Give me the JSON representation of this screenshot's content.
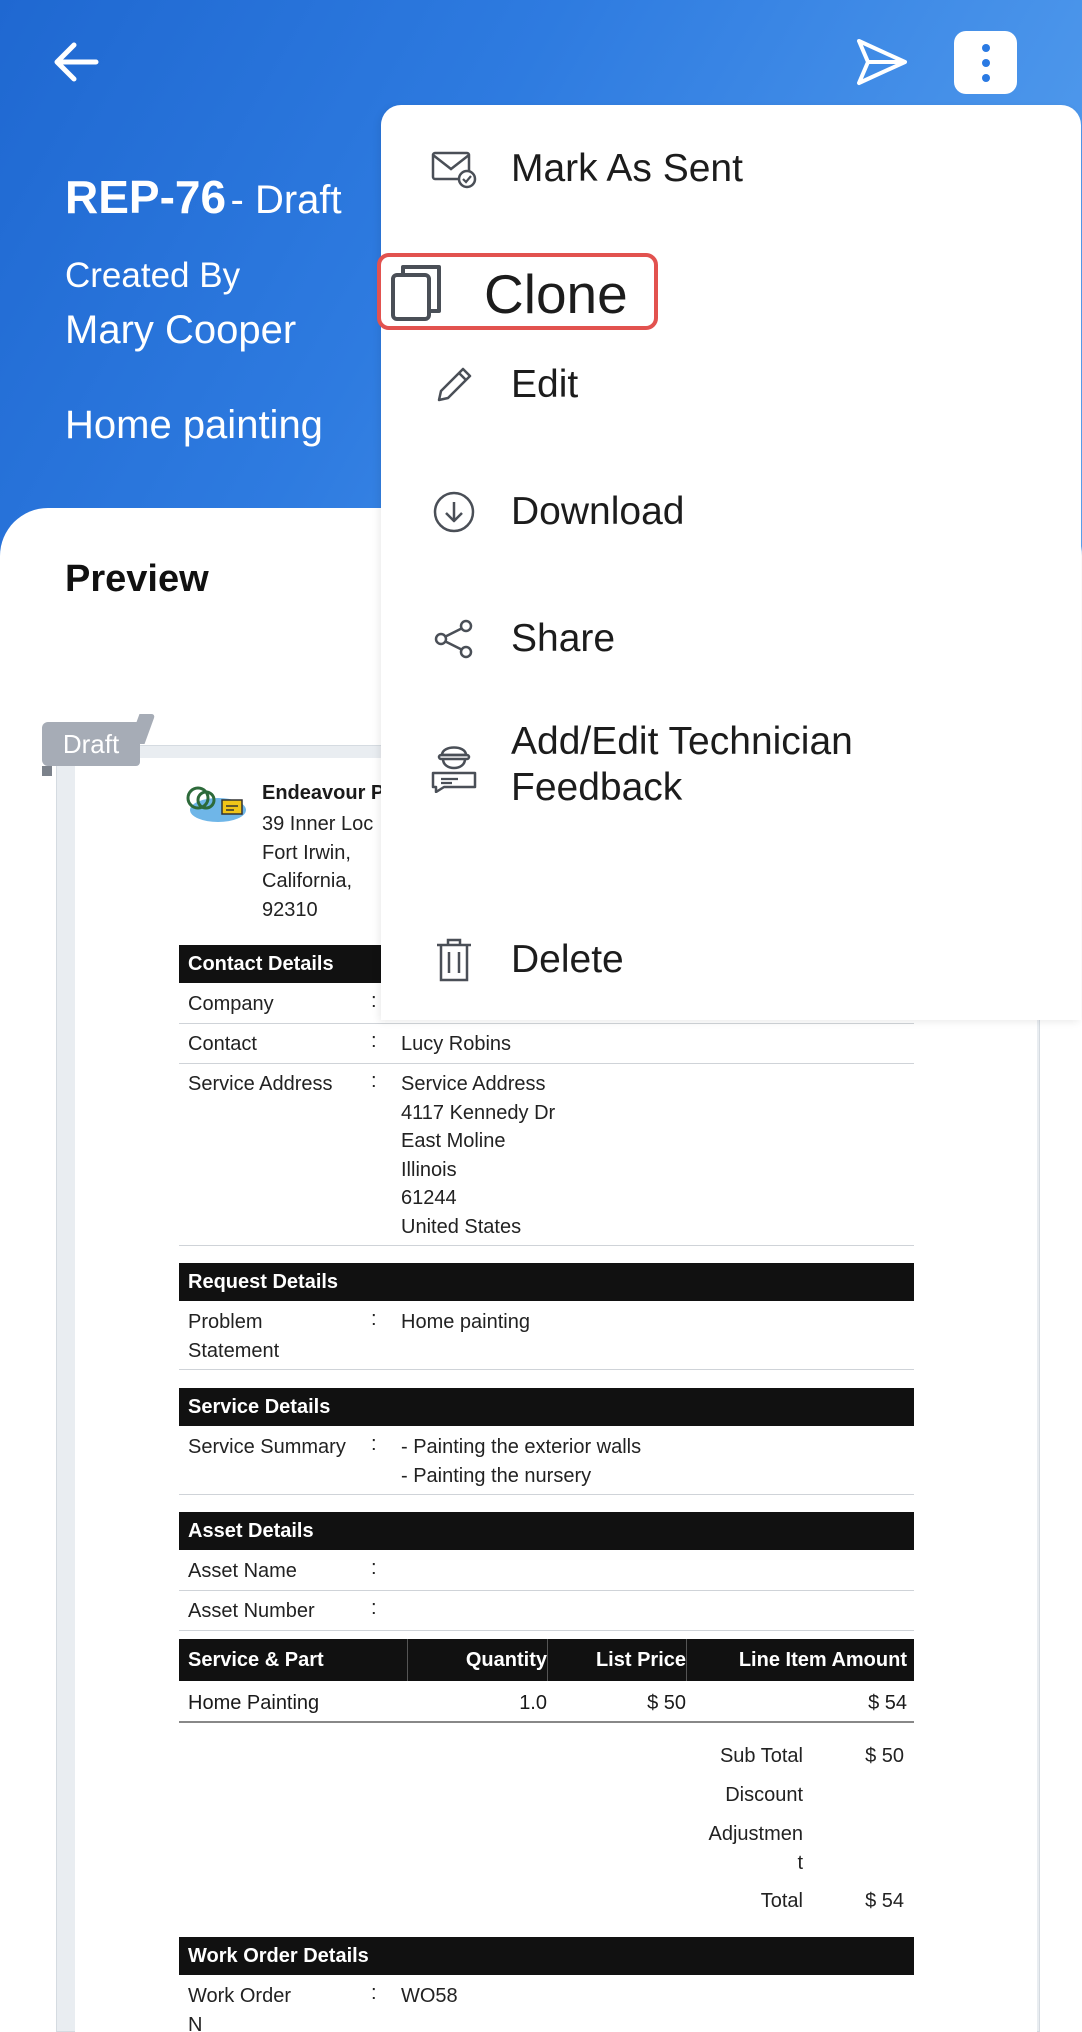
{
  "header": {
    "ref_no": "REP-76",
    "status_text": "- Draft",
    "created_by_label": "Created By",
    "created_by_name": "Mary Cooper",
    "job_title": "Home painting",
    "colors": {
      "primary": "#1f68d1",
      "accent_light": "#5aa3f0"
    }
  },
  "icons": {
    "back": "arrow-left-icon",
    "send": "send-icon",
    "more": "more-vertical-icon"
  },
  "preview": {
    "title": "Preview",
    "draft_tag": "Draft",
    "company": {
      "name": "Endeavour P",
      "address_lines": [
        "39 Inner Loc",
        "Fort Irwin,",
        "California,",
        "92310"
      ]
    },
    "contact_details": {
      "header": "Contact Details",
      "rows": [
        {
          "label": "Company",
          "colon": ":",
          "value": ""
        },
        {
          "label": "Contact",
          "colon": ":",
          "value": "Lucy Robins"
        },
        {
          "label": "Service Address",
          "colon": ":",
          "value_lines": [
            "Service Address",
            "4117 Kennedy Dr",
            "East Moline",
            "Illinois",
            "61244",
            "United States"
          ]
        }
      ]
    },
    "request_details": {
      "header": "Request Details",
      "rows": [
        {
          "label_lines": [
            "Problem",
            "Statement"
          ],
          "colon": ":",
          "value": "Home painting"
        }
      ]
    },
    "service_details": {
      "header": "Service Details",
      "rows": [
        {
          "label": "Service Summary",
          "colon": ":",
          "value_lines": [
            "- Painting the exterior walls",
            "- Painting the nursery"
          ]
        }
      ]
    },
    "asset_details": {
      "header": "Asset Details",
      "rows": [
        {
          "label": "Asset Name",
          "colon": ":",
          "value": ""
        },
        {
          "label": "Asset Number",
          "colon": ":",
          "value": ""
        }
      ]
    },
    "service_parts": {
      "columns": [
        "Service & Part",
        "Quantity",
        "List Price",
        "Line Item Amount"
      ],
      "rows": [
        [
          "Home Painting",
          "1.0",
          "$ 50",
          "$ 54"
        ]
      ]
    },
    "totals": [
      {
        "label": "Sub Total",
        "value": "$ 50"
      },
      {
        "label": "Discount",
        "value": ""
      },
      {
        "label_lines": [
          "Adjustmen",
          "t"
        ],
        "value": ""
      },
      {
        "label": "Total",
        "value": "$ 54"
      }
    ],
    "work_order_details": {
      "header": "Work Order Details",
      "rows": [
        {
          "label": "Work Order",
          "label_cut": "N",
          "colon": ":",
          "value": "WO58"
        }
      ]
    }
  },
  "menu": {
    "items": [
      {
        "label": "Mark As Sent",
        "icon": "mail-check-icon"
      },
      {
        "label": "Clone",
        "icon": "copy-icon",
        "highlighted": true
      },
      {
        "label": "Edit",
        "icon": "pencil-icon"
      },
      {
        "label": "Download",
        "icon": "download-circle-icon"
      },
      {
        "label": "Share",
        "icon": "share-icon"
      },
      {
        "label_lines": [
          "Add/Edit Technician",
          "Feedback"
        ],
        "icon": "technician-feedback-icon"
      },
      {
        "label": "Delete",
        "icon": "trash-icon"
      }
    ],
    "highlight_color": "#e2524f"
  }
}
